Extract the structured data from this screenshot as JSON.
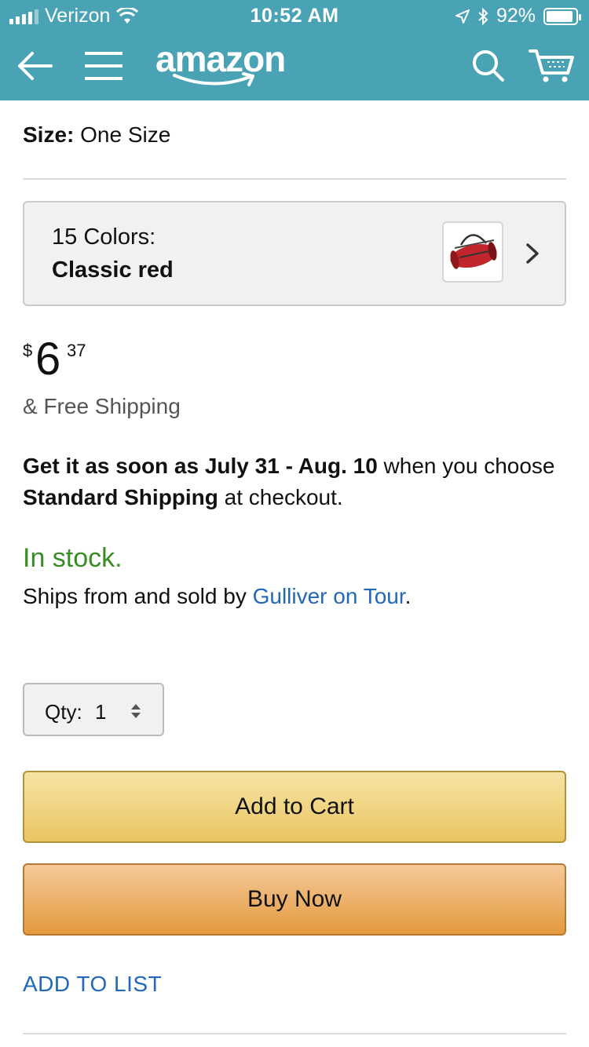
{
  "status_bar": {
    "carrier": "Verizon",
    "time": "10:52 AM",
    "battery": "92%",
    "battery_level": 0.92,
    "icons": [
      "signal-icon",
      "wifi-icon",
      "location-icon",
      "bluetooth-icon",
      "battery-icon"
    ]
  },
  "nav": {
    "logo": "amazon",
    "icons": [
      "back-arrow-icon",
      "hamburger-menu-icon",
      "search-icon",
      "cart-icon"
    ]
  },
  "product": {
    "size_label": "Size:",
    "size_value": "One Size",
    "colors_count": "15 Colors:",
    "color_selected": "Classic red",
    "price": {
      "currency": "$",
      "whole": "6",
      "fraction": "37"
    },
    "free_shipping": "& Free Shipping",
    "delivery": {
      "bold_part": "Get it as soon as July 31 - Aug. 10",
      "mid_text": " when you choose ",
      "shipping_method": "Standard Shipping",
      "end_text": " at checkout."
    },
    "stock_status": "In stock.",
    "ships_prefix": "Ships from and sold by ",
    "seller": "Gulliver on Tour",
    "ships_suffix": "."
  },
  "quantity": {
    "label": "Qty:",
    "value": "1"
  },
  "actions": {
    "add_to_cart": "Add to Cart",
    "buy_now": "Buy Now",
    "add_to_list": "ADD TO LIST"
  },
  "colors": {
    "header_bg": "#4aa3b5",
    "in_stock": "#3a8c24",
    "link": "#2367b8",
    "add_to_cart": "#eac661",
    "buy_now": "#e49a3e"
  }
}
